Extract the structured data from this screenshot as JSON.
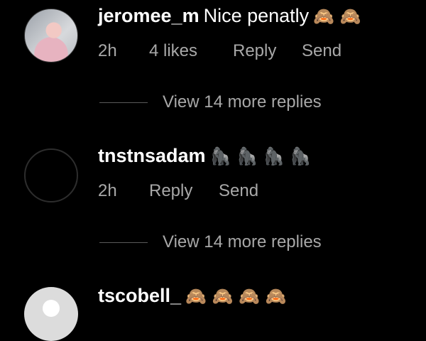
{
  "comments": [
    {
      "username": "jeromee_m",
      "text": "Nice penatly",
      "emoji": "🙈 🙈",
      "time": "2h",
      "likes": "4 likes",
      "reply": "Reply",
      "send": "Send",
      "more_replies": "View 14 more replies"
    },
    {
      "username": "tnstnsadam",
      "text": "",
      "emoji": "🦍 🦍 🦍 🦍",
      "time": "2h",
      "reply": "Reply",
      "send": "Send",
      "more_replies": "View 14 more replies"
    },
    {
      "username": "tscobell_",
      "text": "",
      "emoji": "🙈 🙈 🙈 🙈"
    }
  ]
}
